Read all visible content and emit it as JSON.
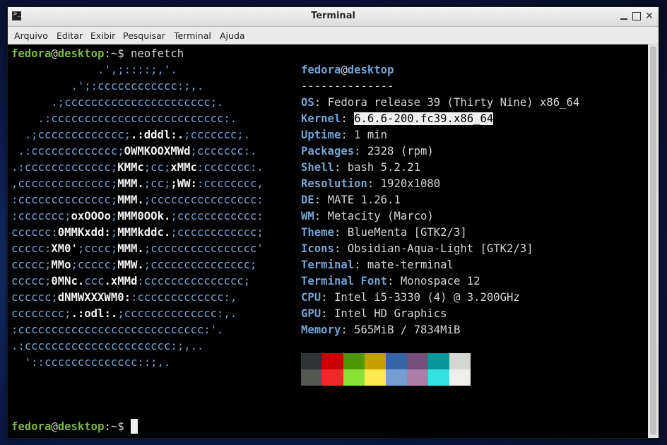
{
  "window": {
    "title": "Terminal",
    "menu": [
      "Arquivo",
      "Editar",
      "Exibir",
      "Pesquisar",
      "Terminal",
      "Ajuda"
    ]
  },
  "prompt": {
    "user": "fedora",
    "at": "@",
    "host": "desktop",
    "path": ":~$ ",
    "command": "neofetch"
  },
  "logo": [
    [
      {
        "t": "             .',;::::;,'.",
        "c": "b"
      }
    ],
    [
      {
        "t": "         .';:cccccccccccc:;,.",
        "c": "b"
      }
    ],
    [
      {
        "t": "      .;cccccccccccccccccccccc;.",
        "c": "b"
      }
    ],
    [
      {
        "t": "    .:cccccccccccccccccccccccccc:.",
        "c": "b"
      }
    ],
    [
      {
        "t": "  .;ccccccccccccc;",
        "c": "b"
      },
      {
        "t": ".:dddl:.",
        "c": "w"
      },
      {
        "t": ";ccccccc;.",
        "c": "b"
      }
    ],
    [
      {
        "t": " .:ccccccccccccc;",
        "c": "b"
      },
      {
        "t": "OWMKOOXMWd",
        "c": "w"
      },
      {
        "t": ";ccccccc:.",
        "c": "b"
      }
    ],
    [
      {
        "t": ".:ccccccccccccc;",
        "c": "b"
      },
      {
        "t": "KMMc",
        "c": "w"
      },
      {
        "t": ";cc;",
        "c": "b"
      },
      {
        "t": "xMMc",
        "c": "w"
      },
      {
        "t": ":ccccccc:.",
        "c": "b"
      }
    ],
    [
      {
        "t": ",cccccccccccccc;",
        "c": "b"
      },
      {
        "t": "MMM.",
        "c": "w"
      },
      {
        "t": ";cc;",
        "c": "b"
      },
      {
        "t": ";WW:",
        "c": "w"
      },
      {
        "t": ":cccccccc,",
        "c": "b"
      }
    ],
    [
      {
        "t": ":cccccccccccccc;",
        "c": "b"
      },
      {
        "t": "MMM.",
        "c": "w"
      },
      {
        "t": ";cccccccccccccccc:",
        "c": "b"
      }
    ],
    [
      {
        "t": ":ccccccc;",
        "c": "b"
      },
      {
        "t": "oxOOOo",
        "c": "w"
      },
      {
        "t": ";",
        "c": "b"
      },
      {
        "t": "MMM0OOk.",
        "c": "w"
      },
      {
        "t": ";cccccccccccc:",
        "c": "b"
      }
    ],
    [
      {
        "t": "cccccc:",
        "c": "b"
      },
      {
        "t": "0MMKxdd:",
        "c": "w"
      },
      {
        "t": ";",
        "c": "b"
      },
      {
        "t": "MMMkddc.",
        "c": "w"
      },
      {
        "t": ";cccccccccccc;",
        "c": "b"
      }
    ],
    [
      {
        "t": "ccccc:",
        "c": "b"
      },
      {
        "t": "XM0'",
        "c": "w"
      },
      {
        "t": ";cccc;",
        "c": "b"
      },
      {
        "t": "MMM.",
        "c": "w"
      },
      {
        "t": ";cccccccccccccccc'",
        "c": "b"
      }
    ],
    [
      {
        "t": "ccccc;",
        "c": "b"
      },
      {
        "t": "MMo",
        "c": "w"
      },
      {
        "t": ";ccccc;",
        "c": "b"
      },
      {
        "t": "MMW.",
        "c": "w"
      },
      {
        "t": ";ccccccccccccccc;",
        "c": "b"
      }
    ],
    [
      {
        "t": "ccccc;",
        "c": "b"
      },
      {
        "t": "0MNc.",
        "c": "w"
      },
      {
        "t": "ccc",
        "c": "b"
      },
      {
        "t": ".xMMd",
        "c": "w"
      },
      {
        "t": ":ccccccccccccccc;",
        "c": "b"
      }
    ],
    [
      {
        "t": "cccccc;",
        "c": "b"
      },
      {
        "t": "dNMWXXXWM0:",
        "c": "w"
      },
      {
        "t": ":ccccccccccccc:,",
        "c": "b"
      }
    ],
    [
      {
        "t": "cccccccc;",
        "c": "b"
      },
      {
        "t": ".:odl:.",
        "c": "w"
      },
      {
        "t": ";cccccccccccccc:,.",
        "c": "b"
      }
    ],
    [
      {
        "t": ":cccccccccccccccccccccccccccc:'.",
        "c": "b"
      }
    ],
    [
      {
        "t": ".:cccccccccccccccccccccc:;,..",
        "c": "b"
      }
    ],
    [
      {
        "t": "  '::cccccccccccccc::;,.",
        "c": "b"
      }
    ]
  ],
  "info": {
    "header_user": "fedora",
    "header_at": "@",
    "header_host": "desktop",
    "separator": "--------------",
    "rows": [
      {
        "label": "OS",
        "value": "Fedora release 39 (Thirty Nine) x86_64"
      },
      {
        "label": "Kernel",
        "value": "6.6.6-200.fc39.x86_64",
        "highlight": true
      },
      {
        "label": "Uptime",
        "value": "1 min"
      },
      {
        "label": "Packages",
        "value": "2328 (rpm)"
      },
      {
        "label": "Shell",
        "value": "bash 5.2.21"
      },
      {
        "label": "Resolution",
        "value": "1920x1080"
      },
      {
        "label": "DE",
        "value": "MATE 1.26.1"
      },
      {
        "label": "WM",
        "value": "Metacity (Marco)"
      },
      {
        "label": "Theme",
        "value": "BlueMenta [GTK2/3]"
      },
      {
        "label": "Icons",
        "value": "Obsidian-Aqua-Light [GTK2/3]"
      },
      {
        "label": "Terminal",
        "value": "mate-terminal"
      },
      {
        "label": "Terminal Font",
        "value": "Monospace 12"
      },
      {
        "label": "CPU",
        "value": "Intel i5-3330 (4) @ 3.200GHz"
      },
      {
        "label": "GPU",
        "value": "Intel HD Graphics"
      },
      {
        "label": "Memory",
        "value": "565MiB / 7834MiB"
      }
    ],
    "label_sep": ": "
  },
  "palette": {
    "normal": [
      "#2e3436",
      "#cc0000",
      "#4e9a06",
      "#c4a000",
      "#3465a4",
      "#75507b",
      "#06989a",
      "#d3d7cf"
    ],
    "bright": [
      "#555753",
      "#ef2929",
      "#8ae234",
      "#fce94f",
      "#729fcf",
      "#ad7fa8",
      "#34e2e2",
      "#eeeeec"
    ]
  },
  "colors": {
    "prompt_green": "#7ab648",
    "label_blue": "#73a4d5",
    "terminal_bg": "#000000",
    "text": "#d3d7cf"
  }
}
